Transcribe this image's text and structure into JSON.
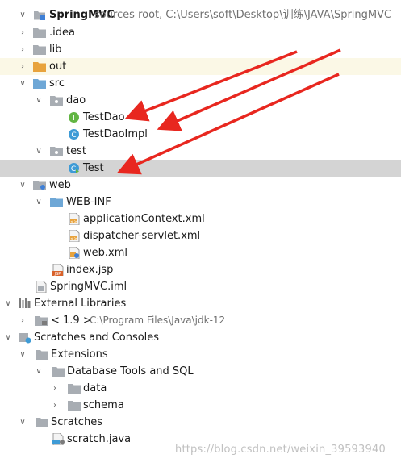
{
  "project_tree": {
    "items": [
      {
        "label": "SpringMVC",
        "extra": "sources root,  C:\\Users\\soft\\Desktop\\训练\\JAVA\\SpringMVC",
        "icon": "module-folder-icon",
        "arrow": "expanded",
        "bold": true
      },
      {
        "label": ".idea",
        "icon": "folder-icon",
        "arrow": "collapsed"
      },
      {
        "label": "lib",
        "icon": "folder-icon",
        "arrow": "collapsed"
      },
      {
        "label": "out",
        "icon": "orange-folder-icon",
        "arrow": "collapsed"
      },
      {
        "label": "src",
        "icon": "source-folder-icon",
        "arrow": "expanded"
      },
      {
        "label": "dao",
        "icon": "package-icon",
        "arrow": "expanded"
      },
      {
        "label": "TestDao",
        "icon": "interface-icon",
        "arrow": "none"
      },
      {
        "label": "TestDaoImpl",
        "icon": "class-icon",
        "arrow": "none"
      },
      {
        "label": "test",
        "icon": "package-icon",
        "arrow": "expanded"
      },
      {
        "label": "Test",
        "icon": "runnable-class-icon",
        "arrow": "none"
      },
      {
        "label": "web",
        "icon": "web-folder-icon",
        "arrow": "expanded"
      },
      {
        "label": "WEB-INF",
        "icon": "blue-folder-icon",
        "arrow": "expanded"
      },
      {
        "label": "applicationContext.xml",
        "icon": "xml-file-icon",
        "arrow": "none"
      },
      {
        "label": "dispatcher-servlet.xml",
        "icon": "xml-file-icon",
        "arrow": "none"
      },
      {
        "label": "web.xml",
        "icon": "web-xml-icon",
        "arrow": "none"
      },
      {
        "label": "index.jsp",
        "icon": "jsp-file-icon",
        "arrow": "none"
      },
      {
        "label": "SpringMVC.iml",
        "icon": "iml-file-icon",
        "arrow": "none"
      },
      {
        "label": "External Libraries",
        "icon": "libraries-icon",
        "arrow": "expanded"
      },
      {
        "label": "< 1.9 >",
        "extra": "C:\\Program Files\\Java\\jdk-12",
        "icon": "jdk-folder-icon",
        "arrow": "collapsed"
      },
      {
        "label": "Scratches and Consoles",
        "icon": "scratches-icon",
        "arrow": "expanded"
      },
      {
        "label": "Extensions",
        "icon": "folder-icon",
        "arrow": "expanded"
      },
      {
        "label": "Database Tools and SQL",
        "icon": "folder-icon",
        "arrow": "expanded"
      },
      {
        "label": "data",
        "icon": "folder-icon",
        "arrow": "collapsed"
      },
      {
        "label": "schema",
        "icon": "folder-icon",
        "arrow": "collapsed"
      },
      {
        "label": "Scratches",
        "icon": "folder-icon",
        "arrow": "expanded"
      },
      {
        "label": "scratch.java",
        "icon": "java-file-icon",
        "arrow": "none"
      }
    ]
  },
  "watermark": "https://blog.csdn.net/weixin_39593940",
  "colors": {
    "selection": "#d4d4d4",
    "excluded_highlight": "#fbf8e6",
    "annotation_arrow": "#e8271f",
    "folder": "#a8adb3",
    "orange_folder": "#e8a33d",
    "source_folder": "#6ea7d6",
    "class_icon": "#3e9bd6",
    "interface_icon": "#62b543"
  }
}
